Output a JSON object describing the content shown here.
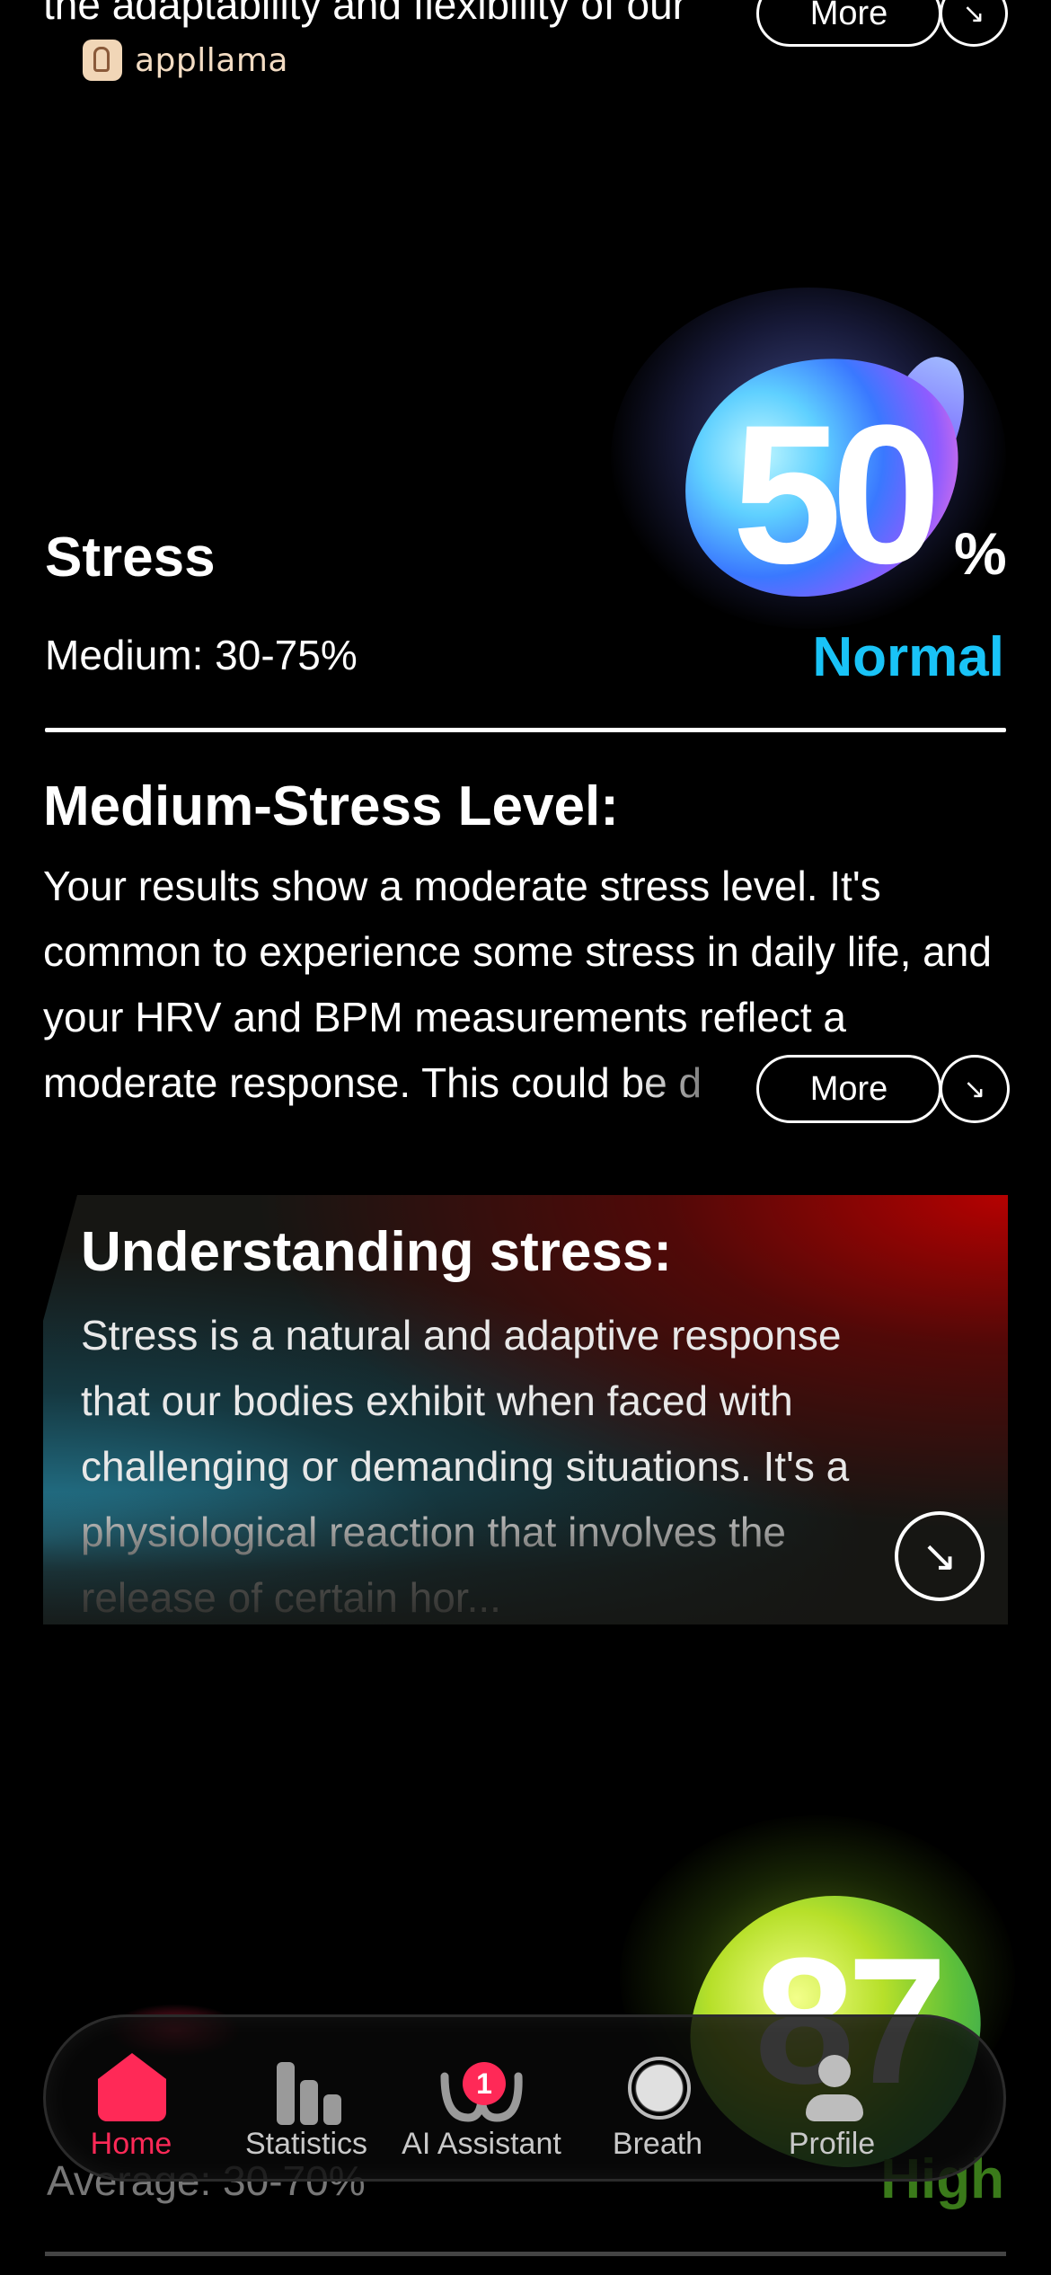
{
  "top": {
    "cut_text": "the adaptability and flexibility of our",
    "more_label": "More",
    "arrow_glyph": "↘"
  },
  "logo": {
    "text": "appllama"
  },
  "stress": {
    "value": "50",
    "unit": "%",
    "title": "Stress",
    "range": "Medium: 30-75%",
    "status": "Normal",
    "status_color": "#19c3f7"
  },
  "section": {
    "heading": "Medium-Stress Level:",
    "body": " Your results show a moderate stress level. It's common to experience some stress in daily life, and your HRV and BPM measurements reflect a moderate response. This could be d",
    "more_label": "More",
    "arrow_glyph": "↘"
  },
  "card": {
    "title": "Understanding stress:",
    "text": "Stress is a natural and adaptive response that our bodies exhibit when faced with challenging or demanding situations. It's a physiological reaction that involves the release of certain hor...",
    "arrow_glyph": "↘"
  },
  "next_metric": {
    "value": "87",
    "avg": "Average: 30-70%",
    "status": "High"
  },
  "tabbar": {
    "items": [
      {
        "label": "Home",
        "icon": "home-icon",
        "active": true
      },
      {
        "label": "Statistics",
        "icon": "bar-chart-icon"
      },
      {
        "label": "AI Assistant",
        "icon": "ai-assistant-icon",
        "badge": "1"
      },
      {
        "label": "Breath",
        "icon": "breath-icon"
      },
      {
        "label": "Profile",
        "icon": "profile-icon"
      }
    ],
    "active_color": "#ff2957"
  }
}
